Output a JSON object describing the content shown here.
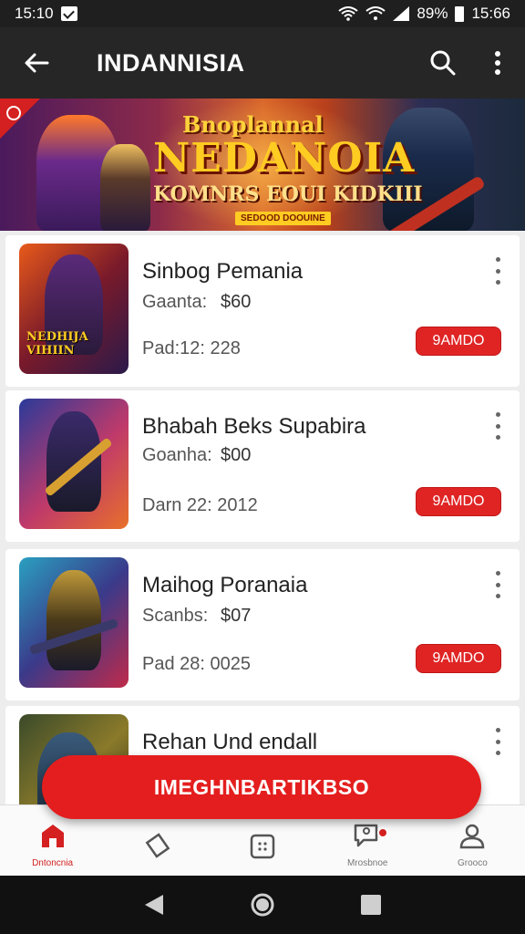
{
  "status_bar": {
    "time_left": "15:10",
    "battery_text": "89%",
    "time_right": "15:66",
    "icons": [
      "check-icon",
      "wifi-icon",
      "signal-icon",
      "battery-icon"
    ]
  },
  "app_bar": {
    "title": "INDANNISIA",
    "icons": [
      "back-arrow-icon",
      "search-icon",
      "more-vert-icon"
    ]
  },
  "banner": {
    "line1": "Bnoplannal",
    "line2": "NEDANOIA",
    "line3": "KOMNRS EOUI KIDKIII",
    "badge": "SEDOOD DOOUINE"
  },
  "items": [
    {
      "title": "Sinbog Pemania",
      "line1_label": "Gaanta:",
      "line1_value": "$60",
      "line2": "Pad:12: 228",
      "button": "9AMDO",
      "thumb_text": "NEDHIJA VIHIIN"
    },
    {
      "title": "Bhabah Beks Supabira",
      "line1_label": "Goanha:",
      "line1_value": "$00",
      "line2": "Darn 22: 2012",
      "button": "9AMDO",
      "thumb_text": ""
    },
    {
      "title": "Maihog Poranaia",
      "line1_label": "Scanbs:",
      "line1_value": "$07",
      "line2": "Pad 28: 0025",
      "button": "9AMDO",
      "thumb_text": ""
    },
    {
      "title": "Rehan Und endall",
      "line1_label": "",
      "line1_value": "",
      "line2": "",
      "button": "",
      "thumb_text": ""
    }
  ],
  "fab_label": "IMEGHNBARTIKBSO",
  "bottom_nav": [
    {
      "label": "Dntoncnia",
      "icon": "home-icon",
      "active": true
    },
    {
      "label": "",
      "icon": "tag-icon",
      "active": false
    },
    {
      "label": "",
      "icon": "grid-square-icon",
      "active": false
    },
    {
      "label": "Mrosbnoe",
      "icon": "chat-person-icon",
      "active": false,
      "badge": true
    },
    {
      "label": "Grooco",
      "icon": "profile-icon",
      "active": false
    }
  ],
  "colors": {
    "accent": "#e02424",
    "app_bar": "#262626",
    "status_bar": "#1f1f1f"
  }
}
